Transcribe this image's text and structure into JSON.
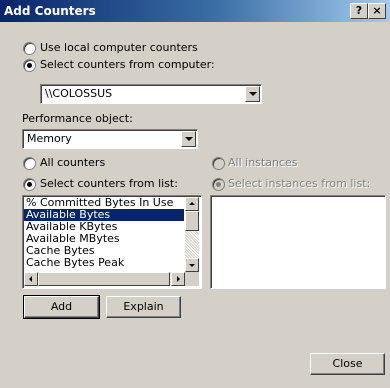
{
  "window": {
    "title": "Add Counters",
    "help_label": "?",
    "close_label": "×"
  },
  "source": {
    "local_label": "Use local computer counters",
    "remote_label": "Select counters from computer:",
    "selected": "remote",
    "computer_value": "\\\\COLOSSUS"
  },
  "performance_object": {
    "label": "Performance object:",
    "value": "Memory"
  },
  "counters": {
    "all_label": "All counters",
    "list_label": "Select counters from list:",
    "selected": "list",
    "items": [
      "% Committed Bytes In Use",
      "Available Bytes",
      "Available KBytes",
      "Available MBytes",
      "Cache Bytes",
      "Cache Bytes Peak"
    ],
    "selected_item": "Available Bytes"
  },
  "instances": {
    "all_label": "All instances",
    "list_label": "Select instances from list:"
  },
  "buttons": {
    "add": "Add",
    "explain": "Explain",
    "close": "Close"
  }
}
